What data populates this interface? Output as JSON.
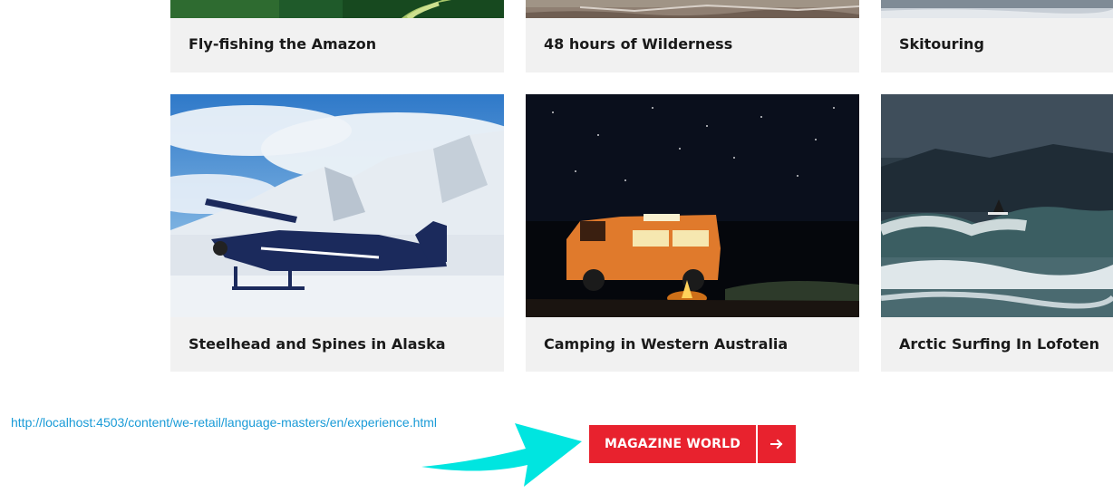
{
  "cards": [
    {
      "title": "Fly-fishing the Amazon",
      "image": "river-aerial-photo"
    },
    {
      "title": "48 hours of Wilderness",
      "image": "rocky-shore-photo"
    },
    {
      "title": "Skitouring",
      "image": "snow-slope-photo"
    },
    {
      "title": "Steelhead and Spines in Alaska",
      "image": "bush-plane-on-snow-photo"
    },
    {
      "title": "Camping in Western Australia",
      "image": "campervan-night-photo"
    },
    {
      "title": "Arctic Surfing In Lofoten",
      "image": "surfer-wave-photo"
    }
  ],
  "status_url": "http://localhost:4503/content/we-retail/language-masters/en/experience.html",
  "cta": {
    "label": "MAGAZINE WORLD",
    "icon": "arrow-right-icon"
  },
  "annotation": {
    "icon": "cyan-pointer-arrow",
    "color": "#00e5e0"
  },
  "colors": {
    "accent": "#e8222e",
    "card_bg": "#f1f1f1",
    "link": "#1a9bd7"
  }
}
